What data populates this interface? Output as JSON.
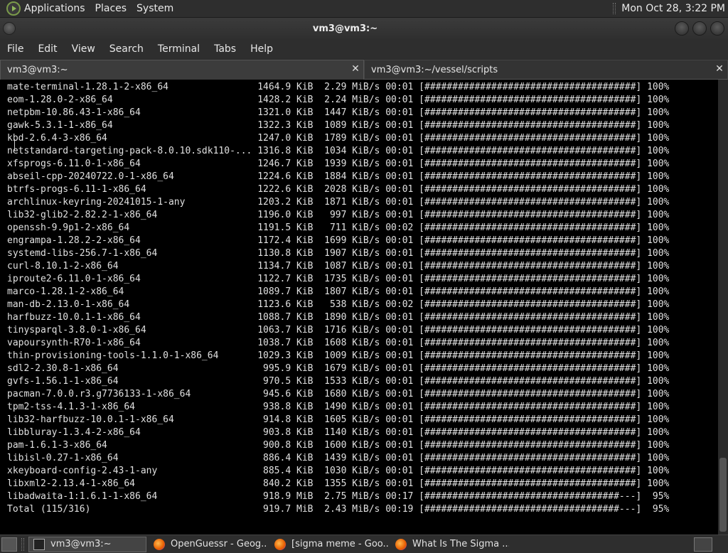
{
  "top_panel": {
    "menus": [
      "Applications",
      "Places",
      "System"
    ],
    "clock": "Mon Oct 28,  3:22 PM"
  },
  "window": {
    "title": "vm3@vm3:~"
  },
  "menubar": [
    "File",
    "Edit",
    "View",
    "Search",
    "Terminal",
    "Tabs",
    "Help"
  ],
  "tabs": [
    {
      "label": "vm3@vm3:~"
    },
    {
      "label": "vm3@vm3:~/vessel/scripts"
    }
  ],
  "terminal_lines": [
    "mate-terminal-1.28.1-2-x86_64                1464.9 KiB  2.29 MiB/s 00:01 [######################################] 100%",
    "eom-1.28.0-2-x86_64                          1428.2 KiB  2.24 MiB/s 00:01 [######################################] 100%",
    "netpbm-10.86.43-1-x86_64                     1321.0 KiB  1447 KiB/s 00:01 [######################################] 100%",
    "gawk-5.3.1-1-x86_64                          1322.3 KiB  1089 KiB/s 00:01 [######################################] 100%",
    "kbd-2.6.4-3-x86_64                           1247.0 KiB  1789 KiB/s 00:01 [######################################] 100%",
    "netstandard-targeting-pack-8.0.10.sdk110-... 1316.8 KiB  1034 KiB/s 00:01 [######################################] 100%",
    "xfsprogs-6.11.0-1-x86_64                     1246.7 KiB  1939 KiB/s 00:01 [######################################] 100%",
    "abseil-cpp-20240722.0-1-x86_64               1224.6 KiB  1884 KiB/s 00:01 [######################################] 100%",
    "btrfs-progs-6.11-1-x86_64                    1222.6 KiB  2028 KiB/s 00:01 [######################################] 100%",
    "archlinux-keyring-20241015-1-any             1203.2 KiB  1871 KiB/s 00:01 [######################################] 100%",
    "lib32-glib2-2.82.2-1-x86_64                  1196.0 KiB   997 KiB/s 00:01 [######################################] 100%",
    "openssh-9.9p1-2-x86_64                       1191.5 KiB   711 KiB/s 00:02 [######################################] 100%",
    "engrampa-1.28.2-2-x86_64                     1172.4 KiB  1699 KiB/s 00:01 [######################################] 100%",
    "systemd-libs-256.7-1-x86_64                  1130.8 KiB  1907 KiB/s 00:01 [######################################] 100%",
    "curl-8.10.1-2-x86_64                         1134.7 KiB  1087 KiB/s 00:01 [######################################] 100%",
    "iproute2-6.11.0-1-x86_64                     1122.7 KiB  1735 KiB/s 00:01 [######################################] 100%",
    "marco-1.28.1-2-x86_64                        1089.7 KiB  1807 KiB/s 00:01 [######################################] 100%",
    "man-db-2.13.0-1-x86_64                       1123.6 KiB   538 KiB/s 00:02 [######################################] 100%",
    "harfbuzz-10.0.1-1-x86_64                     1088.7 KiB  1890 KiB/s 00:01 [######################################] 100%",
    "tinysparql-3.8.0-1-x86_64                    1063.7 KiB  1716 KiB/s 00:01 [######################################] 100%",
    "vapoursynth-R70-1-x86_64                     1038.7 KiB  1608 KiB/s 00:01 [######################################] 100%",
    "thin-provisioning-tools-1.1.0-1-x86_64       1029.3 KiB  1009 KiB/s 00:01 [######################################] 100%",
    "sdl2-2.30.8-1-x86_64                          995.9 KiB  1679 KiB/s 00:01 [######################################] 100%",
    "gvfs-1.56.1-1-x86_64                          970.5 KiB  1533 KiB/s 00:01 [######################################] 100%",
    "pacman-7.0.0.r3.g7736133-1-x86_64             945.6 KiB  1680 KiB/s 00:01 [######################################] 100%",
    "tpm2-tss-4.1.3-1-x86_64                       938.8 KiB  1490 KiB/s 00:01 [######################################] 100%",
    "lib32-harfbuzz-10.0.1-1-x86_64                914.8 KiB  1605 KiB/s 00:01 [######################################] 100%",
    "libbluray-1.3.4-2-x86_64                      903.8 KiB  1140 KiB/s 00:01 [######################################] 100%",
    "pam-1.6.1-3-x86_64                            900.8 KiB  1600 KiB/s 00:01 [######################################] 100%",
    "libisl-0.27-1-x86_64                          886.4 KiB  1439 KiB/s 00:01 [######################################] 100%",
    "xkeyboard-config-2.43-1-any                   885.4 KiB  1030 KiB/s 00:01 [######################################] 100%",
    "libxml2-2.13.4-1-x86_64                       840.2 KiB  1355 KiB/s 00:01 [######################################] 100%",
    "libadwaita-1:1.6.1-1-x86_64                   918.9 MiB  2.75 MiB/s 00:17 [###################################---]  95%",
    "Total (115/316)                               919.7 MiB  2.43 MiB/s 00:19 [###################################---]  95%"
  ],
  "taskbar": {
    "tasks": [
      {
        "label": "vm3@vm3:~",
        "icon": "terminal-icon"
      },
      {
        "label": "OpenGuessr - Geog...",
        "icon": "firefox-icon"
      },
      {
        "label": "[sigma meme - Goo...",
        "icon": "firefox-icon"
      },
      {
        "label": "What Is The Sigma ...",
        "icon": "firefox-icon"
      }
    ]
  },
  "colors": {
    "terminal_bg": "#000000",
    "terminal_fg": "#e0e0e0",
    "panel_bg": "#2e2e2e"
  }
}
